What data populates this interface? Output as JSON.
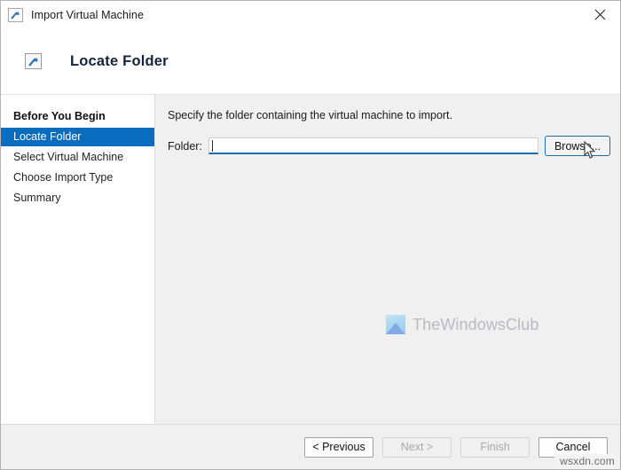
{
  "window": {
    "title": "Import Virtual Machine",
    "title_icon": "import-arrow-icon",
    "close_label": "✕"
  },
  "header": {
    "title": "Locate Folder",
    "icon": "import-arrow-icon"
  },
  "sidebar": {
    "items": [
      {
        "label": "Before You Begin",
        "state": "completed"
      },
      {
        "label": "Locate Folder",
        "state": "current"
      },
      {
        "label": "Select Virtual Machine",
        "state": "pending"
      },
      {
        "label": "Choose Import Type",
        "state": "pending"
      },
      {
        "label": "Summary",
        "state": "pending"
      }
    ],
    "highlight_color": "#0a6cbc"
  },
  "main": {
    "instruction": "Specify the folder containing the virtual machine to import.",
    "folder_label": "Folder:",
    "folder_value": "",
    "folder_placeholder": "",
    "browse_label": "Browse...",
    "focus_color": "#1b6ca8",
    "watermark_text": "TheWindowsClub",
    "watermark_logo": "mountain-logo-icon"
  },
  "footer": {
    "buttons": [
      {
        "label": "< Previous",
        "enabled": true
      },
      {
        "label": "Next >",
        "enabled": false
      },
      {
        "label": "Finish",
        "enabled": false
      },
      {
        "label": "Cancel",
        "enabled": true
      }
    ],
    "site_watermark": "wsxdn.com"
  }
}
